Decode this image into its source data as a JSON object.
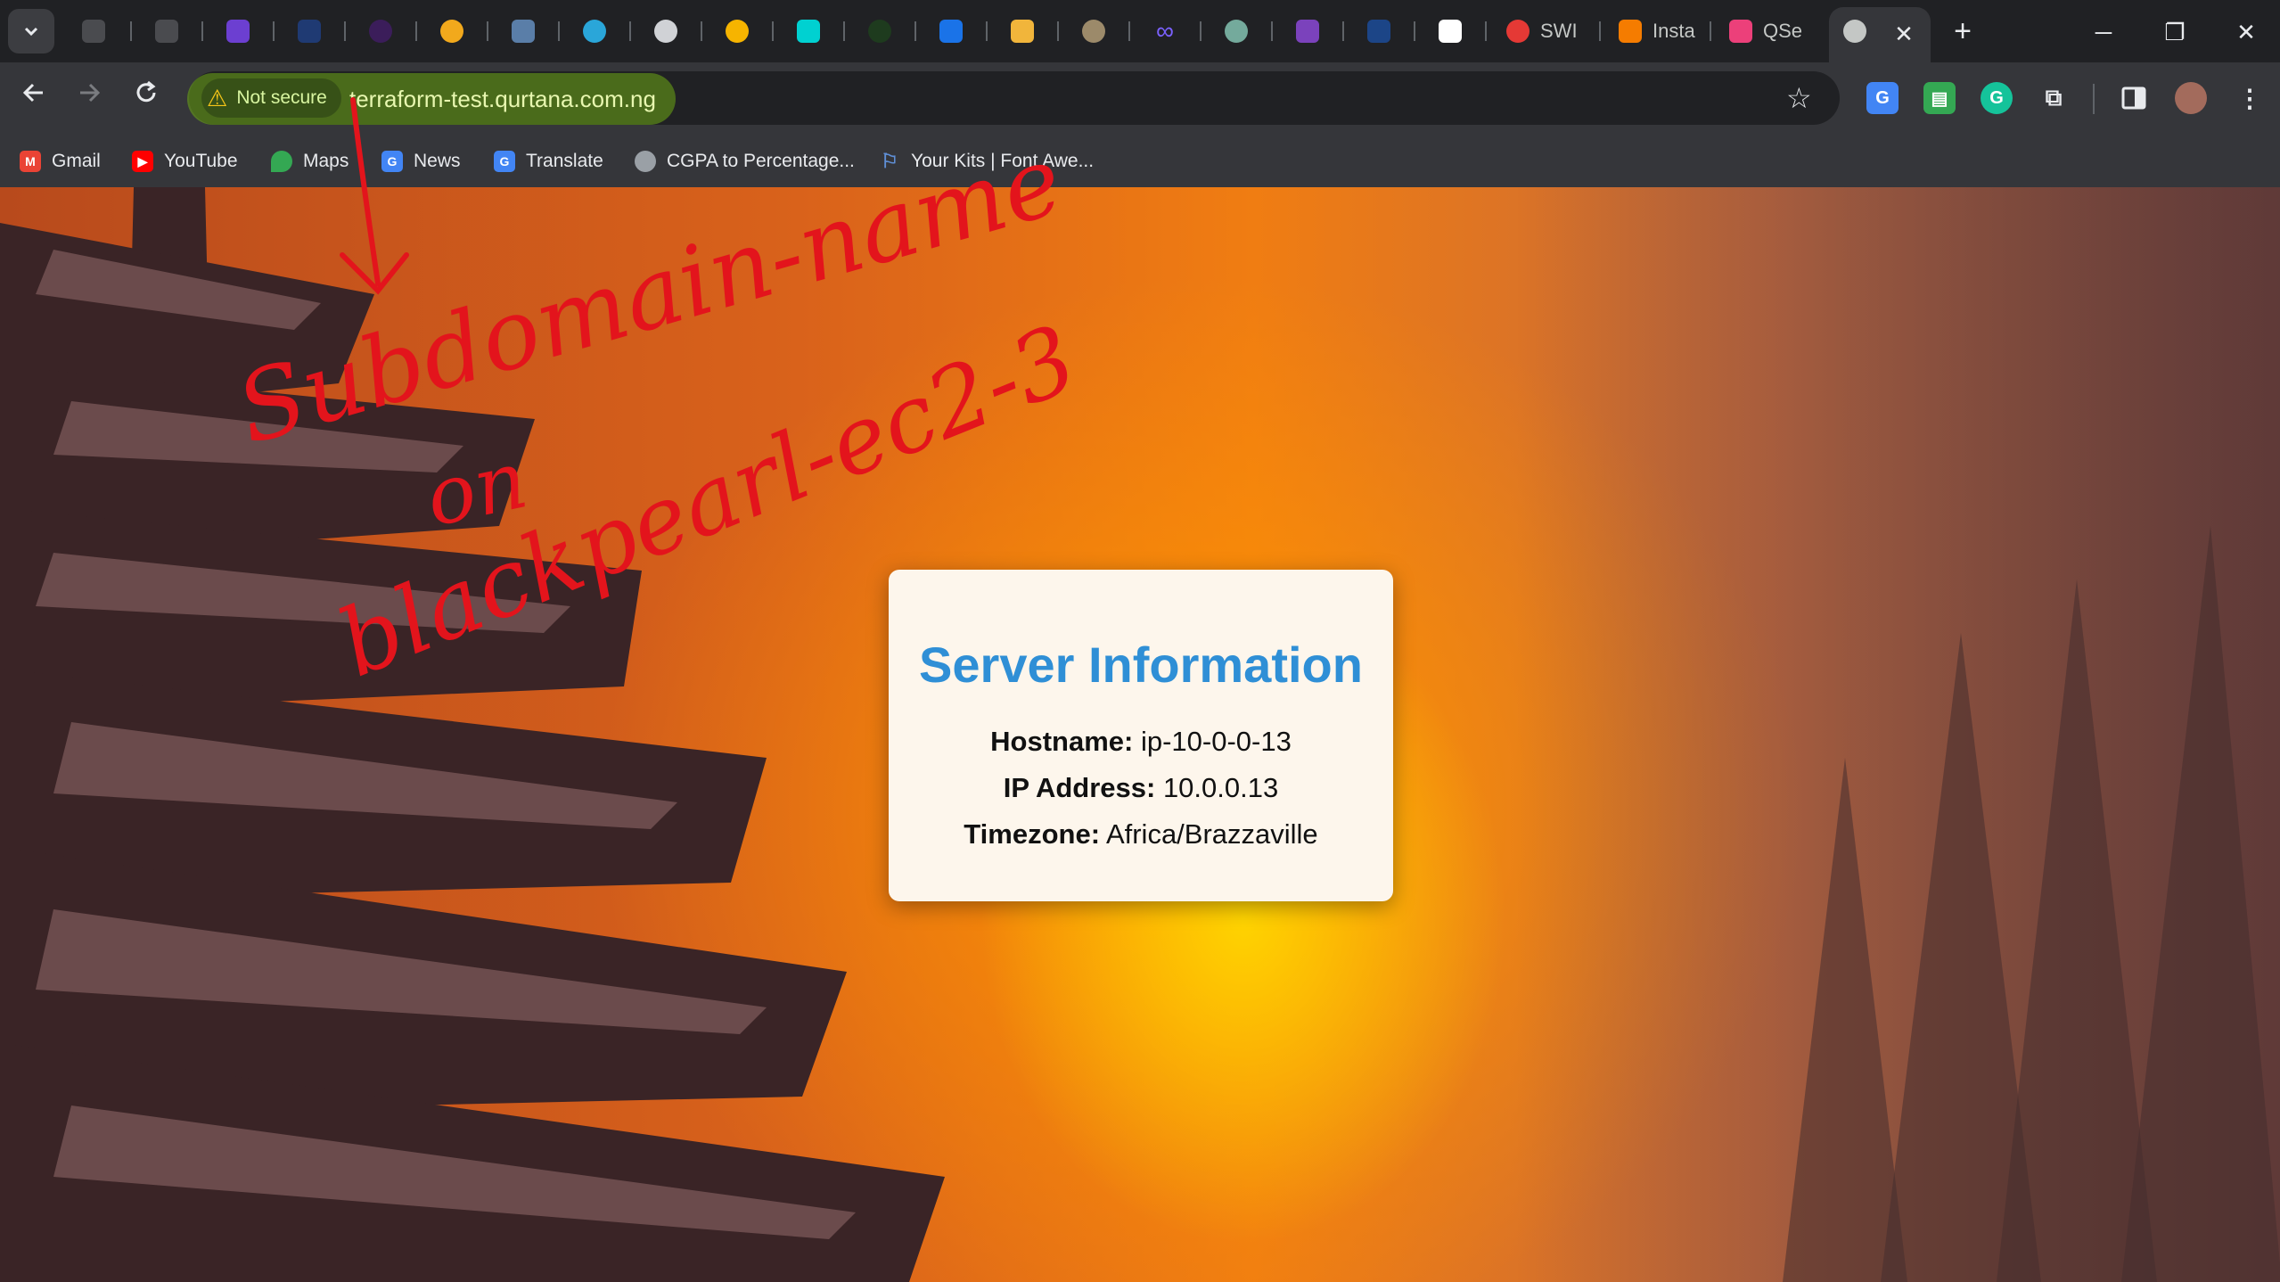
{
  "tabs": {
    "active_tab": {
      "title": "",
      "close_label": "✕"
    },
    "titled": [
      {
        "title": "SWI",
        "color": "#e53935"
      },
      {
        "title": "Insta",
        "color": "#f57c00"
      },
      {
        "title": "QSe",
        "color": "#ec407a"
      }
    ],
    "new_tab_label": "+"
  },
  "window_controls": {
    "minimize": "─",
    "restore": "❐",
    "close": "✕"
  },
  "toolbar": {
    "security_label": "Not secure",
    "url": "terraform-test.qurtana.com.ng"
  },
  "bookmarks": [
    {
      "label": "Gmail",
      "icon": "gmail-icon",
      "color": "#ea4335"
    },
    {
      "label": "YouTube",
      "icon": "youtube-icon",
      "color": "#ff0000"
    },
    {
      "label": "Maps",
      "icon": "maps-icon",
      "color": "#34a853"
    },
    {
      "label": "News",
      "icon": "news-icon",
      "color": "#4285f4"
    },
    {
      "label": "Translate",
      "icon": "translate-icon",
      "color": "#4285f4"
    },
    {
      "label": "CGPA to Percentage...",
      "icon": "globe-icon",
      "color": "#9aa0a6"
    },
    {
      "label": "Your Kits | Font Awe...",
      "icon": "flag-icon",
      "color": "#5f8fd6"
    }
  ],
  "page": {
    "title": "Server Information",
    "rows": [
      {
        "key": "Hostname:",
        "value": "ip-10-0-0-13"
      },
      {
        "key": "IP Address:",
        "value": "10.0.0.13"
      },
      {
        "key": "Timezone:",
        "value": "Africa/Brazzaville"
      }
    ]
  },
  "annotation": {
    "lines": [
      "Subdomain-name",
      "on",
      "blackpearl-ec2-3"
    ],
    "color": "#e3141c"
  }
}
